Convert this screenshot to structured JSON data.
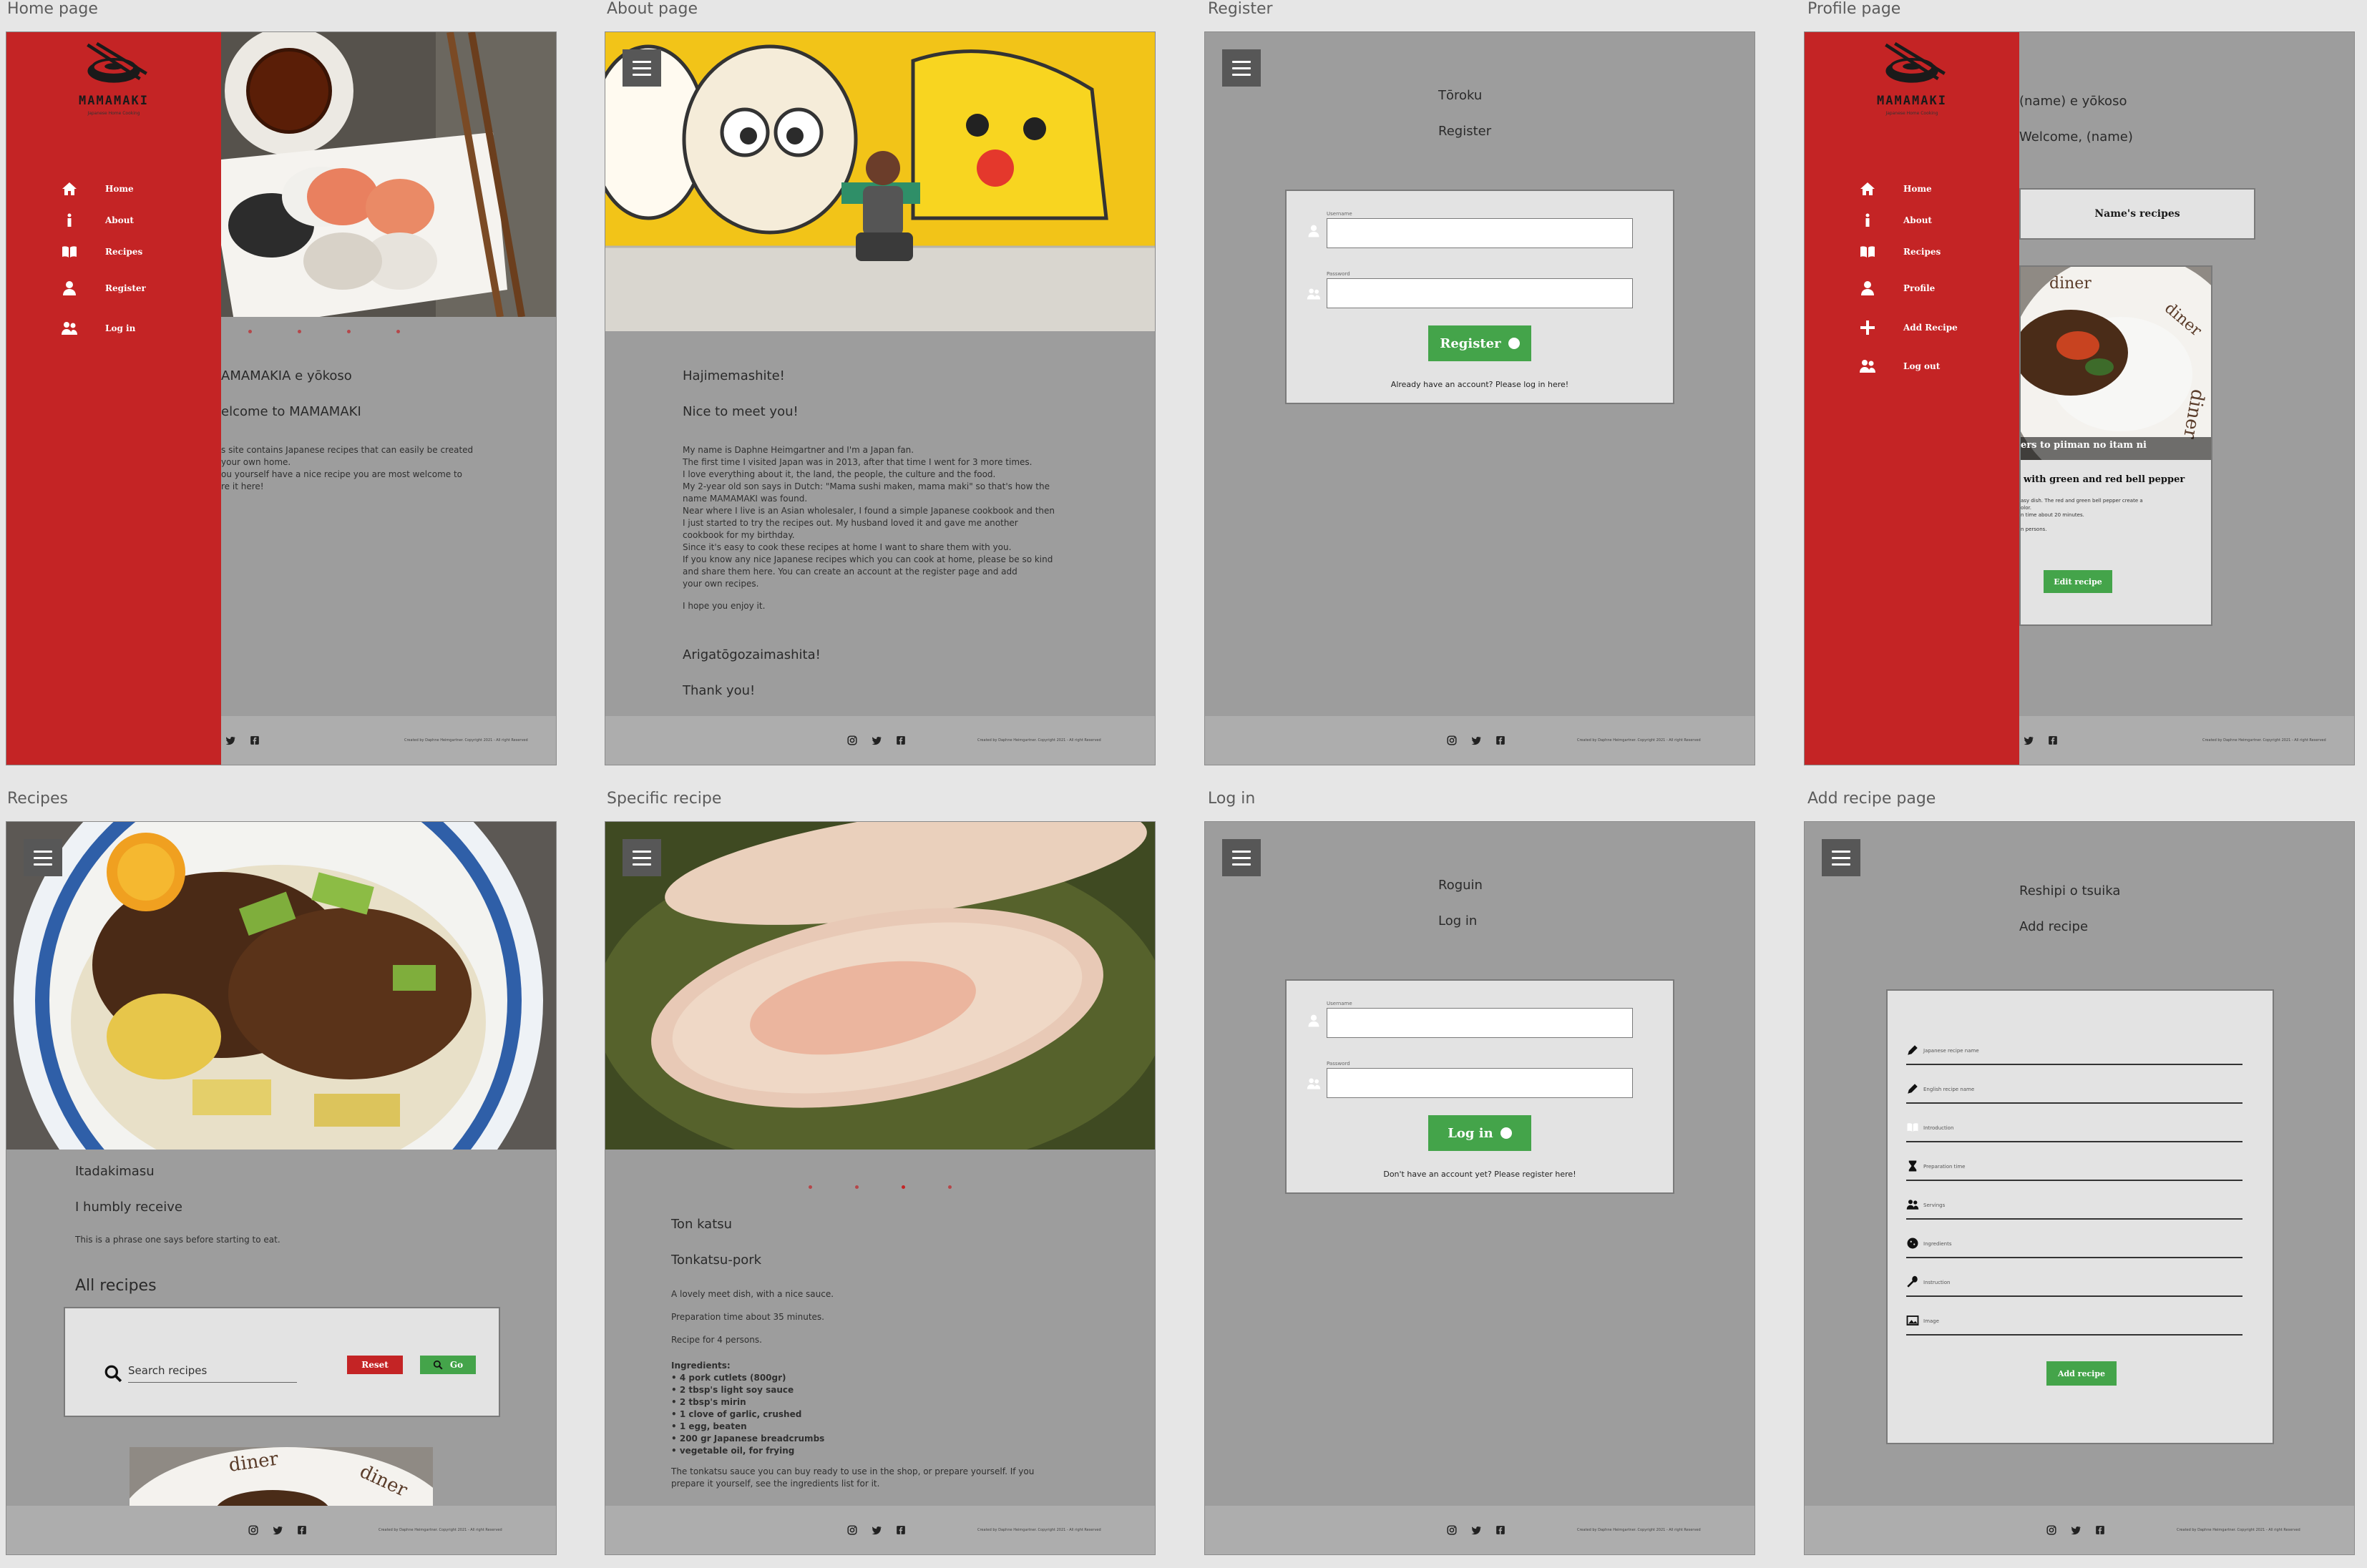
{
  "frames": {
    "home": {
      "title": "Home page"
    },
    "about": {
      "title": "About page"
    },
    "register": {
      "title": "Register"
    },
    "profile": {
      "title": "Profile page"
    },
    "recipes": {
      "title": "Recipes"
    },
    "specific": {
      "title": "Specific recipe"
    },
    "login": {
      "title": "Log in"
    },
    "addrecipe": {
      "title": "Add recipe page"
    }
  },
  "logo": {
    "name": "MAMAMAKI",
    "tagline": "Japanese Home Cooking"
  },
  "nav_main": [
    {
      "label": "Home",
      "icon": "home-icon"
    },
    {
      "label": "About",
      "icon": "info-icon"
    },
    {
      "label": "Recipes",
      "icon": "book-icon"
    },
    {
      "label": "Register",
      "icon": "user-icon"
    },
    {
      "label": "Log in",
      "icon": "users-icon"
    }
  ],
  "nav_profile": [
    {
      "label": "Home",
      "icon": "home-icon"
    },
    {
      "label": "About",
      "icon": "info-icon"
    },
    {
      "label": "Recipes",
      "icon": "book-icon"
    },
    {
      "label": "Profile",
      "icon": "user-check-icon"
    },
    {
      "label": "Add Recipe",
      "icon": "plus-icon"
    },
    {
      "label": "Log out",
      "icon": "user-times-icon"
    }
  ],
  "footer": {
    "copyright": "Created by Daphne Heimgartner. Copyright 2021 - All right Reserved"
  },
  "home": {
    "heading_jp": "AMAMAKIA e yōkoso",
    "heading_en": "elcome to MAMAMAKI",
    "text": [
      "s site contains Japanese recipes that can easily be created",
      "your own home.",
      "ou yourself have a nice recipe you are most welcome to",
      "re it here!"
    ]
  },
  "about": {
    "heading_jp": "Hajimemashite!",
    "heading_en": "Nice to meet you!",
    "text": [
      "My name is Daphne Heimgartner and I'm a Japan fan.",
      "The first time I visited Japan was in 2013, after that time I went for 3 more times.",
      "I love everything about it, the land, the people, the culture and the food.",
      "My 2-year old son says in Dutch: \"Mama sushi maken, mama maki\" so that's how the",
      "name MAMAMAKI was found.",
      "Near where I live is an Asian wholesaler, I found a simple Japanese cookbook and then",
      "I just started to try the recipes out. My husband loved it and gave me another",
      "cookbook for my birthday.",
      "Since it's easy to cook these recipes at home I want to share them with you.",
      "If you know any nice Japanese recipes which you can cook at home, please be so kind",
      "and share them here. You can create an account at the register page and add",
      "your own recipes."
    ],
    "closing": "I hope you enjoy it.",
    "thanks_jp": "Arigatōgozaimashita!",
    "thanks_en": "Thank you!"
  },
  "register": {
    "heading_jp": "Tōroku",
    "heading_en": "Register",
    "username_label": "Username",
    "password_label": "Password",
    "button": "Register",
    "note": "Already have an account? Please log in here!"
  },
  "login": {
    "heading_jp": "Roguin",
    "heading_en": "Log in",
    "username_label": "Username",
    "password_label": "Password",
    "button": "Log in",
    "note": "Don't have an account yet? Please register here!"
  },
  "profile": {
    "heading_jp": "(name) e yōkoso",
    "heading_en": "Welcome, (name)",
    "recipes_button": "Name's recipes",
    "card_caption": "ers to piiman no itam ni",
    "card_title": "with green and red bell pepper",
    "card_text": [
      "asy dish. The red and green bell pepper create a",
      "olor.",
      "n time about 20 minutes.",
      "",
      "n persons."
    ],
    "edit_button": "Edit recipe"
  },
  "recipes": {
    "heading_jp": "Itadakimasu",
    "heading_en": "I humbly receive",
    "text": "This is a phrase one says before starting to eat.",
    "all_recipes": "All recipes",
    "search_placeholder": "Search recipes",
    "reset": "Reset",
    "go": "Go"
  },
  "specific": {
    "heading_jp": "Ton katsu",
    "heading_en": "Tonkatsu-pork",
    "intro": "A lovely meet dish, with a nice sauce.",
    "prep": "Preparation time about 35 minutes.",
    "servings": "Recipe for 4 persons.",
    "ingredients_title": "Ingredients:",
    "ingredients": [
      "• 4 pork cutlets (800gr)",
      "• 2 tbsp's light soy sauce",
      "• 2 tbsp's mirin",
      "• 1 clove of garlic, crushed",
      "• 1 egg, beaten",
      "• 200 gr Japanese breadcrumbs",
      "• vegetable oil, for frying"
    ],
    "note": [
      "The tonkatsu sauce you can buy ready to use in the shop, or prepare yourself. If you",
      "prepare it yourself, see the ingredients list for it."
    ]
  },
  "addrecipe": {
    "heading_jp": "Reshipi o tsuika",
    "heading_en": "Add recipe",
    "fields": [
      {
        "label": "Japanese recipe name",
        "icon": "pencil-icon"
      },
      {
        "label": "English recipe name",
        "icon": "pencil-icon"
      },
      {
        "label": "Introduction",
        "icon": "book-icon"
      },
      {
        "label": "Preparation time",
        "icon": "hourglass-icon"
      },
      {
        "label": "Servings",
        "icon": "users-icon"
      },
      {
        "label": "Ingredients",
        "icon": "cookie-icon"
      },
      {
        "label": "Instruction",
        "icon": "spoon-icon"
      },
      {
        "label": "Image",
        "icon": "image-icon"
      }
    ],
    "button": "Add recipe"
  },
  "colors": {
    "accent_red": "#c42425",
    "button_green": "#44a44a",
    "page_grey": "#9d9d9d",
    "footer_grey": "#adadad"
  }
}
